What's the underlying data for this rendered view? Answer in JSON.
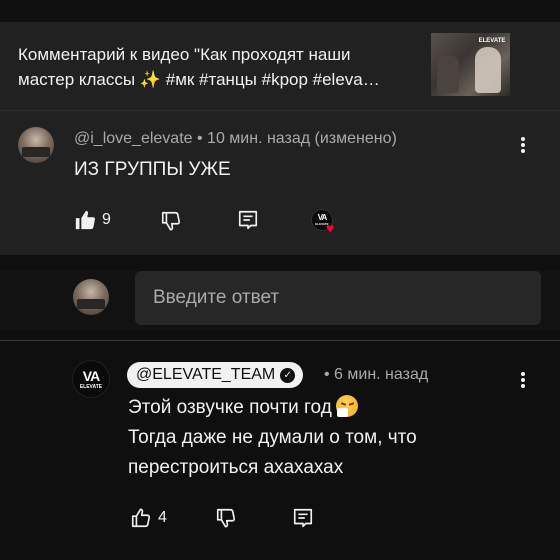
{
  "context": {
    "line1": "Комментарий к видео \"Как проходят наши",
    "line2": "мастер классы",
    "line2_tags": "#мк #танцы #kpop #eleva…",
    "thumbnail_badge": "ELEVATE"
  },
  "comment": {
    "author": "@i_love_elevate",
    "time": "• 10 мин. назад (изменено)",
    "text": "ИЗ ГРУППЫ УЖЕ",
    "likes": "9",
    "creator_heart_logo": "VA",
    "creator_heart_name": "ELEVATE"
  },
  "reply_input": {
    "placeholder": "Введите ответ"
  },
  "reply": {
    "author": "@ELEVATE_TEAM",
    "time": "• 6 мин. назад",
    "line1": "Этой озвучке почти год",
    "line2": "Тогда даже не думали о том, что",
    "line3": "перестроиться ахахахах",
    "likes": "4",
    "avatar_logo": "VA",
    "avatar_name": "ELEVATE"
  },
  "colors": {
    "background": "#0f0f0f",
    "card": "#212121",
    "heart": "#ff0033"
  },
  "icons": [
    "kebab-menu-icon",
    "thumbs-up-icon",
    "thumbs-down-icon",
    "reply-icon",
    "verified-check-icon",
    "heart-icon",
    "sneezing-face-emoji",
    "sparkles-emoji"
  ]
}
